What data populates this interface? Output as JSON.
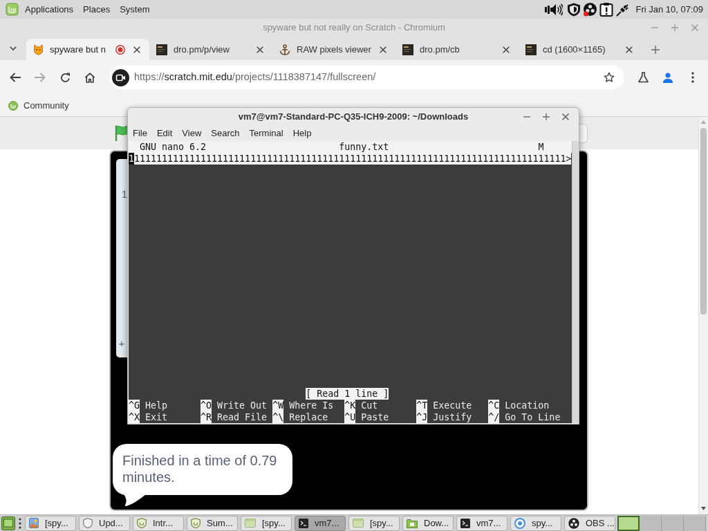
{
  "top_panel": {
    "menus": [
      "Applications",
      "Places",
      "System"
    ],
    "clock": "Fri Jan 10, 07:09"
  },
  "browser": {
    "title": "spyware but not really on Scratch - Chromium",
    "tabs": [
      {
        "title": "spyware but n",
        "kind": "cat",
        "recording": true,
        "selected": true
      },
      {
        "title": "dro.pm/p/view",
        "kind": "thumbnail",
        "recording": false,
        "selected": false
      },
      {
        "title": "RAW pixels viewer",
        "kind": "anchor",
        "recording": false,
        "selected": false
      },
      {
        "title": "dro.pm/cb",
        "kind": "thumbnail",
        "recording": false,
        "selected": false
      },
      {
        "title": "cd (1600×1165)",
        "kind": "thumbnail",
        "recording": false,
        "selected": false
      }
    ],
    "url": {
      "scheme": "https://",
      "host": "scratch.mit.edu",
      "path": "/projects/1118387147/fullscreen/"
    },
    "bookmarks": [
      "Community"
    ]
  },
  "stage": {
    "list_monitor": {
      "index": "1",
      "add": "+"
    },
    "speech_bubble": "Finished in a time of 0.79 minutes."
  },
  "terminal": {
    "title": "vm7@vm7-Standard-PC-Q35-ICH9-2009: ~/Downloads",
    "menus": [
      "File",
      "Edit",
      "View",
      "Search",
      "Terminal",
      "Help"
    ],
    "nano": {
      "version": "GNU nano 6.2",
      "filename": "funny.txt",
      "flag": "M",
      "lines": [
        {
          "cursor": "1",
          "text": "111111111111111111111111111111111111111111111111111111111111111111111111111111",
          "overflow": ">"
        }
      ],
      "status": "[ Read 1 line ]",
      "shortcuts": [
        [
          {
            "key": "^G",
            "label": "Help"
          },
          {
            "key": "^O",
            "label": "Write Out"
          },
          {
            "key": "^W",
            "label": "Where Is"
          },
          {
            "key": "^K",
            "label": "Cut"
          },
          {
            "key": "^T",
            "label": "Execute"
          },
          {
            "key": "^C",
            "label": "Location"
          }
        ],
        [
          {
            "key": "^X",
            "label": "Exit"
          },
          {
            "key": "^R",
            "label": "Read File"
          },
          {
            "key": "^\\",
            "label": "Replace"
          },
          {
            "key": "^U",
            "label": "Paste"
          },
          {
            "key": "^J",
            "label": "Justify"
          },
          {
            "key": "^/",
            "label": "Go To Line"
          }
        ]
      ]
    }
  },
  "taskbar": {
    "items": [
      {
        "label": "[spy...",
        "kind": "image",
        "selected": false
      },
      {
        "label": "Upd...",
        "kind": "shield",
        "selected": false
      },
      {
        "label": "Intr...",
        "kind": "badge",
        "selected": false
      },
      {
        "label": "Sum...",
        "kind": "badge",
        "selected": false
      },
      {
        "label": "[spy...",
        "kind": "window",
        "selected": false
      },
      {
        "label": "vm7...",
        "kind": "terminal",
        "selected": true
      },
      {
        "label": "[spy...",
        "kind": "window",
        "selected": false
      },
      {
        "label": "Dow...",
        "kind": "folder",
        "selected": false
      },
      {
        "label": "vm7...",
        "kind": "terminal",
        "selected": false
      },
      {
        "label": "spy...",
        "kind": "browser",
        "selected": false
      },
      {
        "label": "OBS ...",
        "kind": "obs",
        "selected": false
      }
    ],
    "workspaces": [
      {
        "selected": true
      },
      {
        "selected": false
      },
      {
        "selected": false
      },
      {
        "selected": false
      }
    ]
  }
}
